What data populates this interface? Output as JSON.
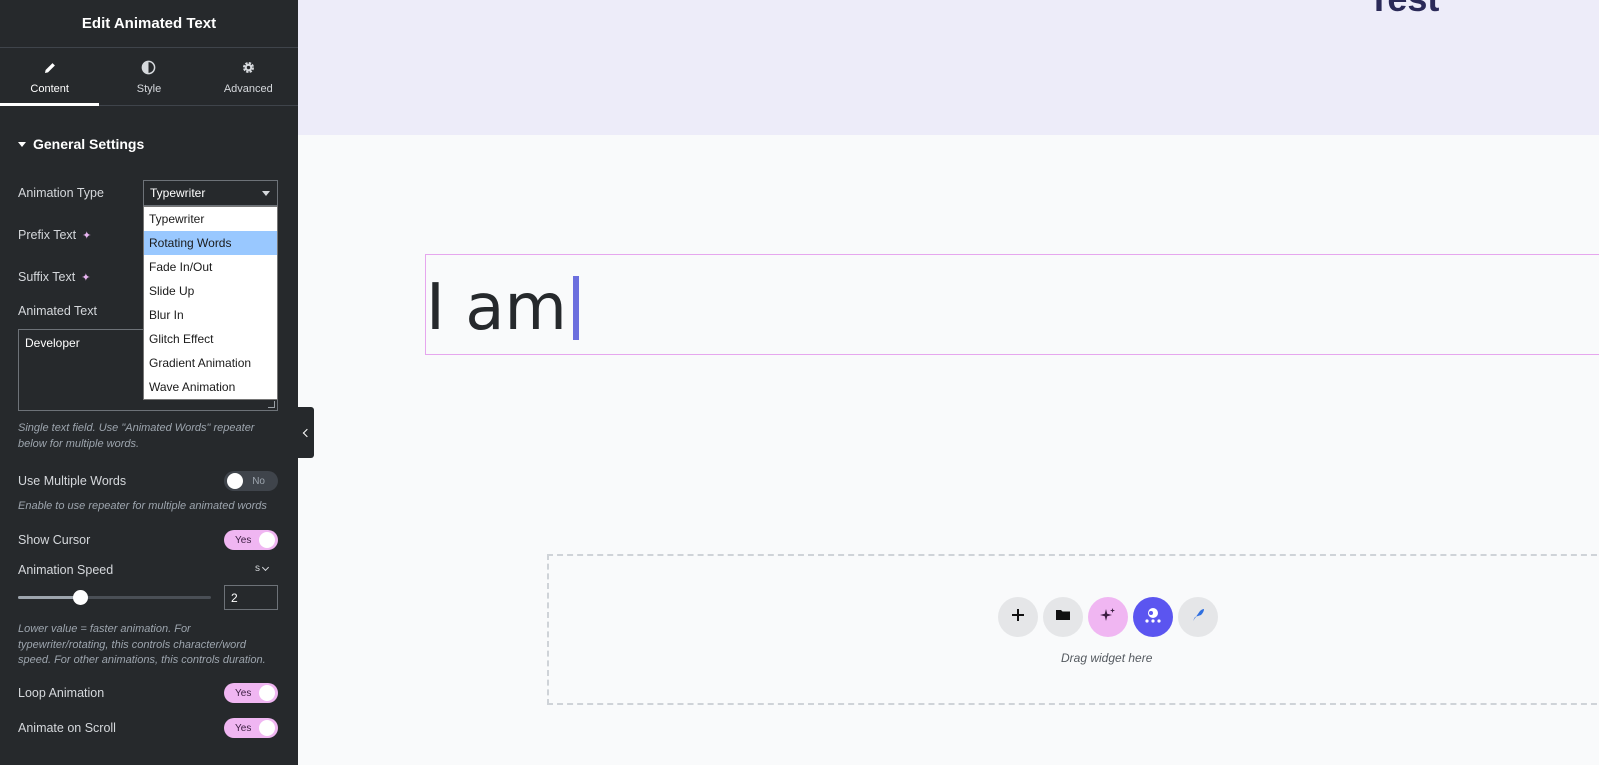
{
  "panel": {
    "title": "Edit Animated Text",
    "tabs": [
      {
        "label": "Content",
        "icon": "pencil-icon"
      },
      {
        "label": "Style",
        "icon": "contrast-icon"
      },
      {
        "label": "Advanced",
        "icon": "gear-icon"
      }
    ],
    "section": "General Settings",
    "fields": {
      "animation_type_label": "Animation Type",
      "animation_type_value": "Typewriter",
      "prefix_label": "Prefix Text",
      "suffix_label": "Suffix Text",
      "animated_text_label": "Animated Text",
      "animated_text_value": "Developer",
      "animated_text_help": "Single text field. Use \"Animated Words\" repeater below for multiple words.",
      "use_multiple_label": "Use Multiple Words",
      "use_multiple_value": "No",
      "use_multiple_help": "Enable to use repeater for multiple animated words",
      "show_cursor_label": "Show Cursor",
      "show_cursor_value": "Yes",
      "speed_label": "Animation Speed",
      "speed_unit": "s",
      "speed_value": "2",
      "speed_fraction": 0.32,
      "speed_help": "Lower value = faster animation. For typewriter/rotating, this controls character/word speed. For other animations, this controls duration.",
      "loop_label": "Loop Animation",
      "loop_value": "Yes",
      "scroll_label": "Animate on Scroll",
      "scroll_value": "Yes"
    },
    "dropdown_options": [
      "Typewriter",
      "Rotating Words",
      "Fade In/Out",
      "Slide Up",
      "Blur In",
      "Glitch Effect",
      "Gradient Animation",
      "Wave Animation"
    ],
    "dropdown_highlighted": "Rotating Words"
  },
  "canvas": {
    "heading": "Test",
    "animated_preview": "I am",
    "drop_zone_label": "Drag widget here",
    "fab_buttons": [
      "plus-icon",
      "folder-icon",
      "sparkle-icon",
      "cloud-icon",
      "feather-icon"
    ]
  },
  "colors": {
    "panel_bg": "#26292c",
    "accent_pink": "#f0b6f2",
    "accent_purple": "#5b55f0",
    "dropdown_highlight": "#99c8ff",
    "cursor": "#6c6fde"
  }
}
